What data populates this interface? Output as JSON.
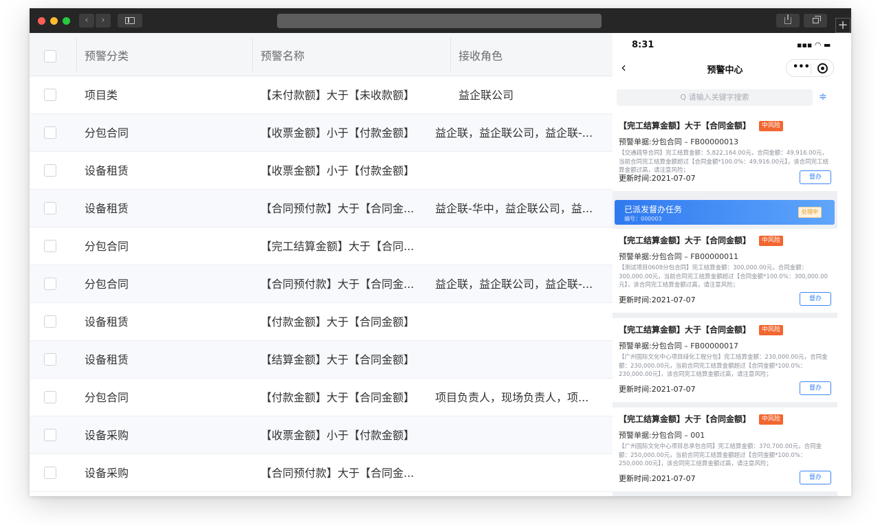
{
  "table": {
    "headers": [
      "预警分类",
      "预警名称",
      "接收角色"
    ],
    "rows": [
      {
        "category": "项目类",
        "name": "【未付款额】大于【未收款额】",
        "roles": "益企联公司"
      },
      {
        "category": "分包合同",
        "name": "【收票金额】小于【付款金额】",
        "roles": "益企联，益企联公司，益企联-..."
      },
      {
        "category": "设备租赁",
        "name": "【收票金额】小于【付款金额】",
        "roles": ""
      },
      {
        "category": "设备租赁",
        "name": "【合同预付款】大于【合同金...",
        "roles": "益企联-华中，益企联公司，益..."
      },
      {
        "category": "分包合同",
        "name": "【完工结算金额】大于【合同...",
        "roles": ""
      },
      {
        "category": "分包合同",
        "name": "【合同预付款】大于【合同金...",
        "roles": "益企联，益企联公司，益企联-..."
      },
      {
        "category": "设备租赁",
        "name": "【付款金额】大于【合同金额】",
        "roles": ""
      },
      {
        "category": "设备租赁",
        "name": "【结算金额】大于【合同金额】",
        "roles": ""
      },
      {
        "category": "分包合同",
        "name": "【付款金额】大于【合同金额】",
        "roles": "项目负责人，现场负责人，项..."
      },
      {
        "category": "设备采购",
        "name": "【收票金额】小于【付款金额】",
        "roles": ""
      },
      {
        "category": "设备采购",
        "name": "【合同预付款】大于【合同金...",
        "roles": ""
      }
    ]
  },
  "phone": {
    "time": "8:31",
    "status_icons": "▪▪▪ ◠ ▬",
    "back_icon": "chevron-left-icon",
    "title": "预警中心",
    "search_placeholder": "Q 请输入关键字搜索",
    "cards": [
      {
        "title": "【完工结算金额】大于【合同金额】",
        "risk": "中风险",
        "sub": "预警单据:分包合同 – FB00000013",
        "desc": "【交通疏导合同】完工结算金额：5,822,164.00元，合同金额：49,916.00元，当前合同完工结算金额超过【合同金额*100.0%：49,916.00元】，该合同完工结算金额过高，请注意风险；",
        "time": "更新时间:2021-07-07",
        "button": "督办"
      },
      {
        "title": "【完工结算金额】大于【合同金额】",
        "risk": "中风险",
        "sub": "预警单据:分包合同 – FB00000011",
        "desc": "【测试项目0608分包合同】完工结算金额：300,000.00元，合同金额：300,000.00元，当前合同完工结算金额超过【合同金额*100.0%：300,000.00元】，该合同完工结算金额过高，请注意风险；",
        "time": "更新时间:2021-07-07",
        "button": "督办"
      },
      {
        "title": "【完工结算金额】大于【合同金额】",
        "risk": "中风险",
        "sub": "预警单据:分包合同 – FB00000017",
        "desc": "【广州国际文化中心项目绿化工程分包】完工结算金额：230,000.00元，合同金额：230,000.00元，当前合同完工结算金额超过【合同金额*100.0%：230,000.00元】，该合同完工结算金额过高，请注意风险；",
        "time": "更新时间:2021-07-07",
        "button": "督办"
      },
      {
        "title": "【完工结算金额】大于【合同金额】",
        "risk": "中风险",
        "sub": "预警单据:分包合同 – 001",
        "desc": "【广州国际文化中心项目总承包合同】完工结算金额：370,700.00元，合同金额：250,000.00元，当前合同完工结算金额超过【合同金额*100.0%：250,000.00元】，该合同完工结算金额过高，请注意风险；",
        "time": "更新时间:2021-07-07",
        "button": "督办"
      }
    ],
    "task_banner": {
      "title": "已派发督办任务",
      "number": "编号：000003",
      "status": "处理中"
    }
  },
  "colors": {
    "accent": "#3a84f5",
    "risk": "#f2662f",
    "titlebar": "#262626"
  }
}
